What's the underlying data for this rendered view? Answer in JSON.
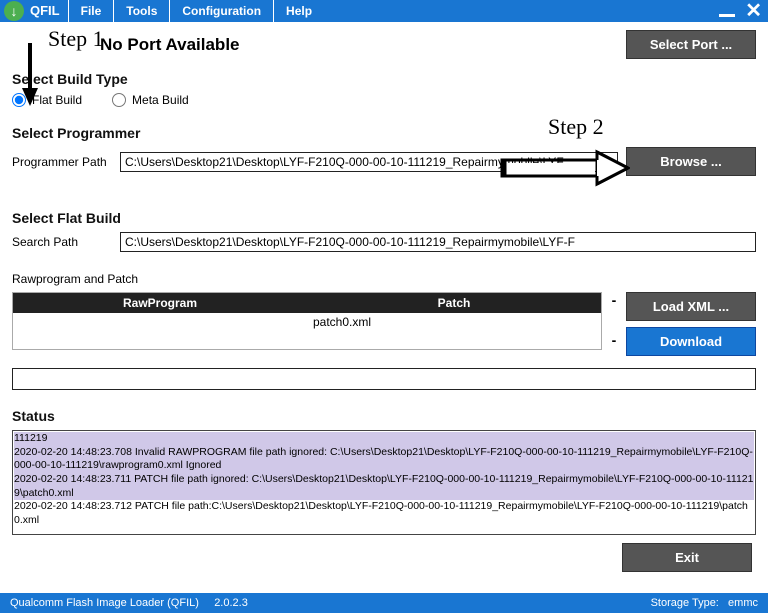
{
  "app": {
    "name": "QFIL"
  },
  "menu": {
    "file": "File",
    "tools": "Tools",
    "config": "Configuration",
    "help": "Help"
  },
  "port": {
    "title": "No Port Available",
    "select_btn": "Select Port ..."
  },
  "build_type": {
    "header": "Select Build Type",
    "flat": "Flat Build",
    "meta": "Meta Build"
  },
  "programmer": {
    "header": "Select Programmer",
    "label": "Programmer Path",
    "value": "C:\\Users\\Desktop21\\Desktop\\LYF-F210Q-000-00-10-111219_Repairmymobile\\LYF",
    "browse": "Browse ..."
  },
  "flat": {
    "header": "Select Flat Build",
    "label": "Search Path",
    "value": "C:\\Users\\Desktop21\\Desktop\\LYF-F210Q-000-00-10-111219_Repairmymobile\\LYF-F"
  },
  "rawpatch_label": "Rawprogram and Patch",
  "table": {
    "col1": "RawProgram",
    "col2": "Patch",
    "patch_val": "patch0.xml",
    "plus": "-",
    "minus": "-"
  },
  "buttons": {
    "loadxml": "Load XML ...",
    "download": "Download",
    "exit": "Exit"
  },
  "status": {
    "header": "Status",
    "l0": "111219",
    "l1": "2020-02-20 14:48:23.708   Invalid RAWPROGRAM file path ignored: C:\\Users\\Desktop21\\Desktop\\LYF-F210Q-000-00-10-111219_Repairmymobile\\LYF-F210Q-000-00-10-111219\\rawprogram0.xml Ignored",
    "l2": "2020-02-20 14:48:23.711   PATCH file path ignored: C:\\Users\\Desktop21\\Desktop\\LYF-F210Q-000-00-10-111219_Repairmymobile\\LYF-F210Q-000-00-10-111219\\patch0.xml",
    "l3": "2020-02-20 14:48:23.712   PATCH file path:C:\\Users\\Desktop21\\Desktop\\LYF-F210Q-000-00-10-111219_Repairmymobile\\LYF-F210Q-000-00-10-111219\\patch0.xml"
  },
  "statusbar": {
    "left_app": "Qualcomm Flash Image Loader (QFIL)",
    "version": "2.0.2.3",
    "storage_label": "Storage Type:",
    "storage_val": "emmc"
  },
  "annot": {
    "step1": "Step 1",
    "step2": "Step 2"
  }
}
